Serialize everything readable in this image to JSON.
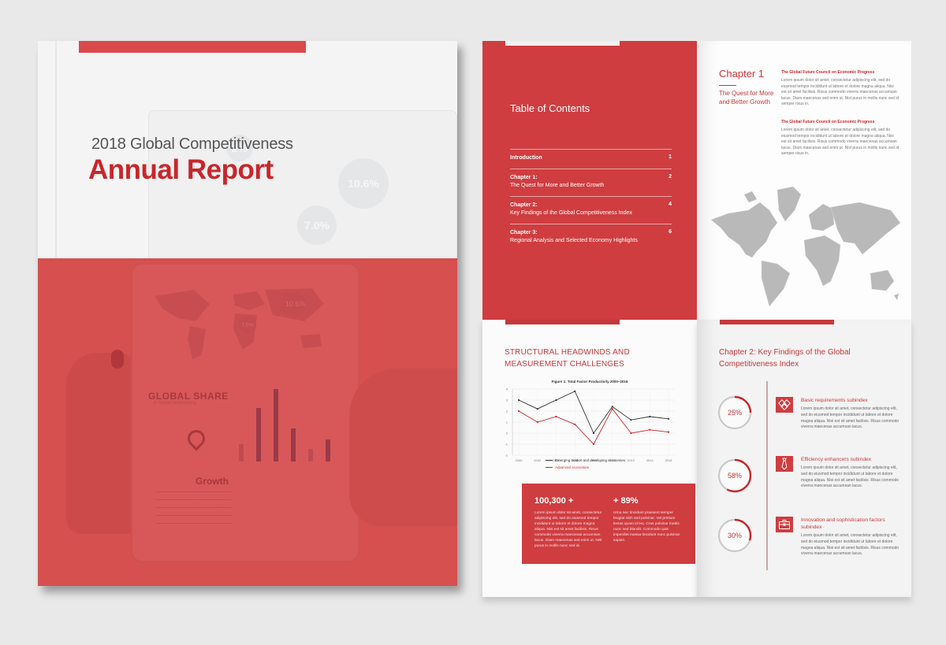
{
  "cover": {
    "subtitle": "2018 Global Competitiveness",
    "title": "Annual Report",
    "tablet": {
      "bubble_values": [
        "10.6%",
        "7.0%",
        "2%"
      ],
      "panel_title": "GLOBAL SHARE",
      "panel_subtitle": "of Social Networking",
      "growth_label": "Growth"
    }
  },
  "toc": {
    "title": "Table of Contents",
    "items": [
      {
        "heading": "Introduction",
        "subtitle": "",
        "page": "1"
      },
      {
        "heading": "Chapter 1:",
        "subtitle": "The Quest for More and Better Growth",
        "page": "2"
      },
      {
        "heading": "Chapter 2:",
        "subtitle": "Key Findings of the Global Competitiveness Index",
        "page": "4"
      },
      {
        "heading": "Chapter 3:",
        "subtitle": "Regional Analysis and Selected Economy Highlights",
        "page": "6"
      }
    ]
  },
  "chapter1": {
    "title": "Chapter 1",
    "subtitle": "The Quest for More and Better Growth",
    "sections": [
      {
        "heading": "The Global Future Council on Economic Progress",
        "body": "Lorem ipsum dolor sit amet, consectetur adipiscing elit, sed do eiusmod tempor incididunt ut labore et dolore magna aliqua. Nisi est sit amet facilisis. Risus commodo viverra maecenas accumsan lacus. Diam maecenas sed enim ut. Nisl purus in mollis nunc sed id semper risus in."
      },
      {
        "heading": "The Global Future Council on Economic Progress",
        "body": "Lorem ipsum dolor sit amet, consectetur adipiscing elit, sed do eiusmod tempor incididunt ut labore et dolore magna aliqua. Nisi est sit amet facilisis. Risus commodo viverra maecenas accumsan lacus. Diam maecenas sed enim ut. Nisl purus in mollis nunc sed id semper risus in."
      }
    ]
  },
  "chart_page": {
    "heading": "STRUCTURAL HEADWINDS AND MEASUREMENT CHALLENGES",
    "stats": [
      {
        "value": "100,300 +",
        "body": "Lorem ipsum dolor sit amet, consectetur adipiscing elit, sed do eiusmod tempor incididunt ut labore et dolore magna aliqua. Nisi est sit amet facilisis. Risus commodo viverra maecenas accumsan lacus. Diam maecenas sed enim ut. Nisl purus in mollis nunc sed id."
      },
      {
        "value": "+ 89%",
        "body": "Urna nec tincidunt praesent semper feugiat nibh sed pulvinar. Vel pretium lectus quam id leo. Cras pulvinar mattis nunc sed blandit. Commodo quis imperdiet massa tincidunt nunc pulvinar sapien."
      }
    ]
  },
  "chart_data": {
    "type": "line",
    "title": "Figure 1: Total Factor Productivity 2000–2016",
    "xlabel": "",
    "ylabel": "",
    "x": [
      "2000",
      "2002",
      "2004",
      "2006",
      "2008",
      "2010",
      "2012",
      "2014",
      "2016"
    ],
    "ylim": [
      -2,
      4
    ],
    "yticks": [
      -2,
      -1,
      0,
      1,
      2,
      3,
      4
    ],
    "grid": true,
    "legend_position": "bottom",
    "series": [
      {
        "name": "Emerging market and developing economies",
        "color": "#333333",
        "values": [
          3.0,
          2.2,
          3.0,
          3.8,
          0.0,
          2.4,
          1.2,
          1.5,
          1.3
        ]
      },
      {
        "name": "Advanced economies",
        "color": "#c8262b",
        "values": [
          2.0,
          1.0,
          1.5,
          0.8,
          -1.0,
          2.2,
          0.0,
          0.3,
          0.1
        ]
      }
    ]
  },
  "chapter2": {
    "heading": "Chapter 2: Key Findings of the Global Competitiveness Index",
    "findings": [
      {
        "percent": 25,
        "percent_label": "25%",
        "icon": "diamonds-icon",
        "title": "Basic requirements subindex",
        "body": "Lorem ipsum dolor sit amet, consectetur adipiscing elit, sed do eiusmod tempor incididunt ut labore et dolore magna aliqua. Nisi est sit amet facilisis. Risus commodo viverra maecenas accumsan lacus."
      },
      {
        "percent": 58,
        "percent_label": "58%",
        "icon": "tie-icon",
        "title": "Efficiency enhancers subindex",
        "body": "Lorem ipsum dolor sit amet, consectetur adipiscing elit, sed do eiusmod tempor incididunt ut labore et dolore magna aliqua. Nisi est sit amet facilisis. Risus commodo viverra maecenas accumsan lacus."
      },
      {
        "percent": 30,
        "percent_label": "30%",
        "icon": "briefcase-icon",
        "title": "Innovation and sophistication factors subindex",
        "body": "Lorem ipsum dolor sit amet, consectetur adipiscing elit, sed do eiusmod tempor incididunt ut labore et dolore magna aliqua. Nisi est sit amet facilisis. Risus commodo viverra maecenas accumsan lacus."
      }
    ]
  },
  "colors": {
    "brand_red": "#cf3d40",
    "title_red": "#c8262b",
    "gauge_track": "#c9c9c9",
    "map_gray": "#b9b9b9"
  }
}
